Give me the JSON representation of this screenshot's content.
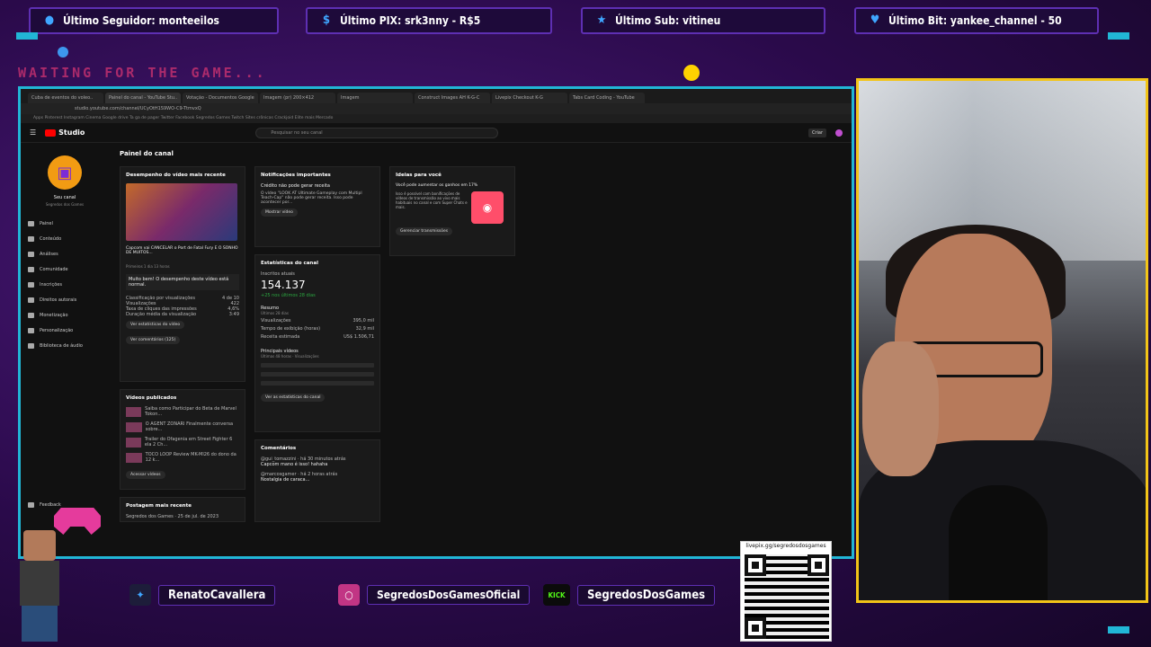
{
  "alerts": {
    "follower": "Último Seguidor: monteeilos",
    "pix": "Último PIX: srk3nny - R$5",
    "sub": "Último Sub: vitineu",
    "bit": "Último Bit: yankee_channel - 50"
  },
  "waiting_text": "WAITING FOR THE GAME...",
  "browser": {
    "tabs": [
      "Cuba de eventos do voleo..",
      "Painel do canal - YouTube Stu..",
      "Votação - Documentos Google",
      "Imagem (pr) 200×412",
      "Imagem",
      "Construct Images AH K-G-C",
      "Livepix Checkout K-G",
      "Tabs Card Coding - YouTube"
    ],
    "url": "studio.youtube.com/channel/UCyOtH1S9WO-C9-TtmvxQ",
    "bookmarks": "Apps  Pinterest  Instagram  Cinema  Google drive  Ta ga de pager  Twitter  Facebook  Segredos Games  Twitch  Sites crônicas  Crackjoid  Elite mais  Mercado"
  },
  "studio": {
    "logo": "Studio",
    "search_placeholder": "Pesquisar no seu canal",
    "create_label": "Criar",
    "channel_name": "Seu canal",
    "channel_sub": "Segredos dos Games",
    "nav": [
      "Painel",
      "Conteúdo",
      "Análises",
      "Comunidade",
      "Inscrições",
      "Direitos autorais",
      "Monetização",
      "Personalização",
      "Biblioteca de áudio"
    ],
    "feedback": "Feedback",
    "page_title": "Painel do canal",
    "latest_video": {
      "heading": "Desempenho do vídeo mais recente",
      "thumb_title": "Capcom vai CANCELAR o Port de Fatal Fury E O SONHO DE MUITOS...",
      "period": "Primeiros 1 dia 13 horas",
      "highlight": "Muito bem! O desempenho deste vídeo está normal.",
      "rows": [
        [
          "Classificação por visualizações",
          "4 de 10"
        ],
        [
          "Visualizações",
          "422"
        ],
        [
          "Taxa de cliques das impressões",
          "4,6%"
        ],
        [
          "Duração média da visualização",
          "3:49"
        ]
      ],
      "btn_stats": "Ver estatísticas do vídeo",
      "btn_comments": "Ver comentários (125)"
    },
    "published": {
      "heading": "Vídeos publicados",
      "items": [
        "Saiba como Participar do Beta de Marvel Tokon...",
        "O AGENT ZONARI Finalmente conversa sobre...",
        "Trailer do Ofagenia em Street Fighter 6 ela 2 Ch...",
        "TOCO LOOP Review MK-Ml26 do dono da 12 k..."
      ],
      "btn": "Acessar vídeos"
    },
    "latest_post": "Postagem mais recente",
    "post_meta": "Segredos dos Games · 25 de jul. de 2023",
    "notifications": {
      "heading": "Notificações importantes",
      "title": "Crédito não pode gerar receita",
      "body": "O vídeo \"LOOK AT Ultimate Gameplay com Multipl Teach-Cap\" não pode gerar receita. Isso pode acontecer por...",
      "btn": "Mostrar vídeo"
    },
    "stats": {
      "heading": "Estatísticas do canal",
      "subs_label": "Inscritos atuais",
      "subs_value": "154.137",
      "subs_delta": "+25 nos últimos 28 dias",
      "summary": "Resumo",
      "summary_sub": "Últimos 28 dias",
      "rows": [
        [
          "Visualizações",
          "395,0 mil"
        ],
        [
          "Tempo de exibição (horas)",
          "32,9 mil"
        ],
        [
          "Receita estimada",
          "US$ 1.506,71"
        ]
      ],
      "top_videos": "Principais vídeos",
      "top_sub": "Últimas 48 horas · Visualizações",
      "btn": "Ver as estatísticas do canal"
    },
    "comments": {
      "heading": "Comentários",
      "items": [
        "@gui_tomazzini · há 30 minutos atrás",
        "Capcom mano é isso! hahaha",
        "@marcosgamer · há 2 horas atrás",
        "Nostalgia de caraca..."
      ]
    },
    "ideas": {
      "heading": "Ideias para você",
      "title": "Você pode aumentar os ganhos em 17%",
      "body": "Isso é possível com bonificações de vídeos de transmissão ao vivo mais habituais no canal e com Super Chats e mais.",
      "btn": "Gerenciar transmissões"
    }
  },
  "social": {
    "twitter": "RenatoCavallera",
    "instagram": "SegredosDosGamesOficial",
    "kick_badge": "KICK",
    "kick": "SegredosDosGames"
  },
  "qr_url": "livepix.gg/segredosdosgames",
  "colors": {
    "frame": "#21b6d6",
    "cam_border": "#f2c418",
    "accent": "#5e2fb3"
  }
}
